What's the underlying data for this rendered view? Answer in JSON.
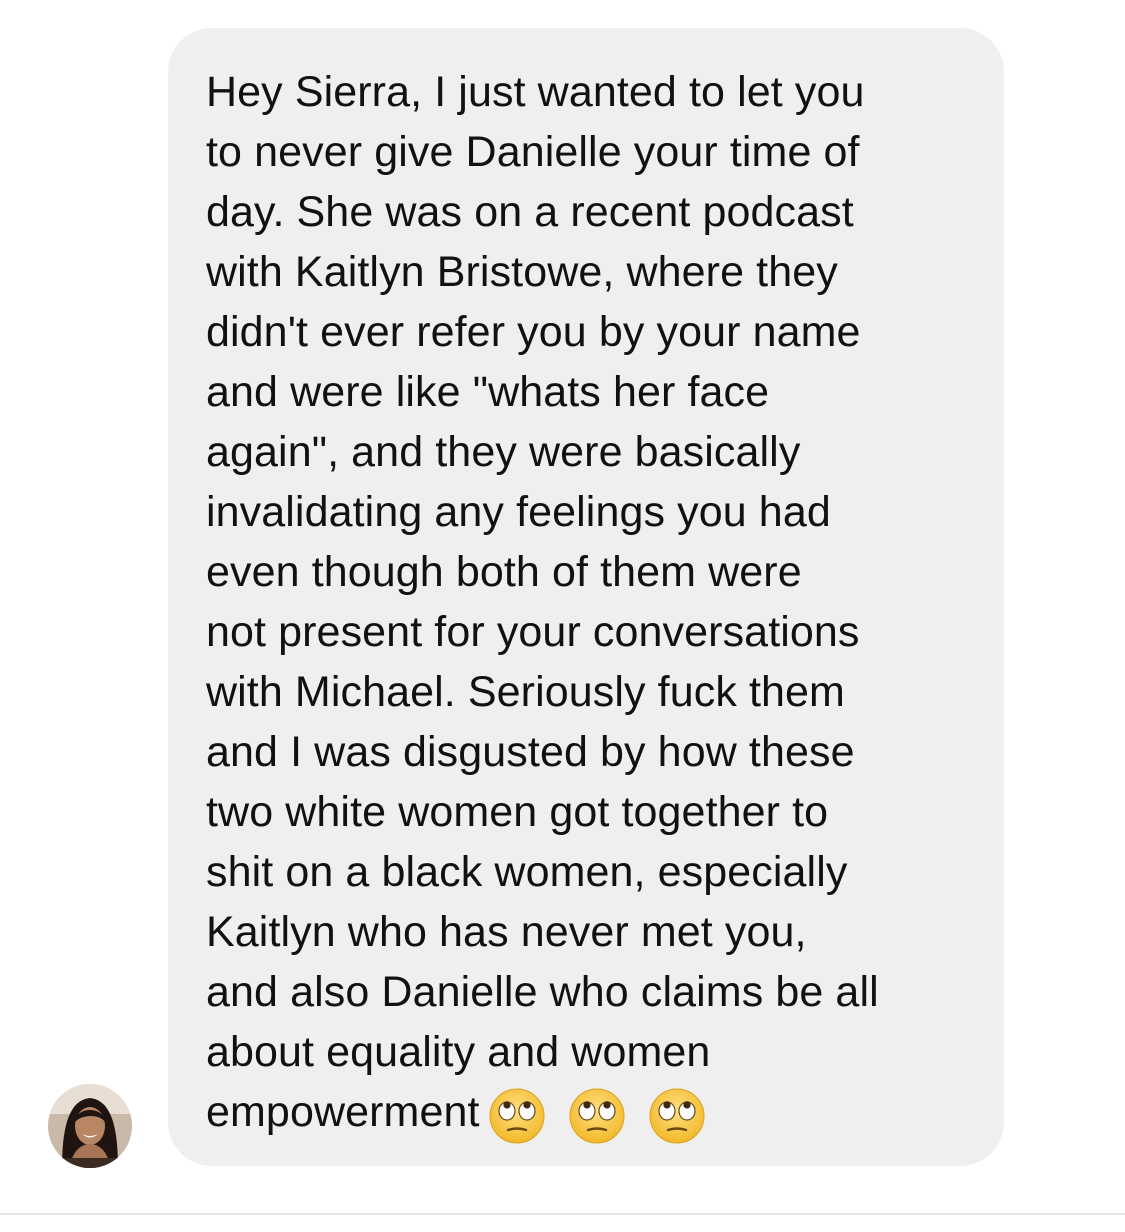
{
  "message": {
    "lines": [
      "Hey Sierra, I just wanted to let you",
      "to never give Danielle your time of",
      "day. She was on a recent podcast",
      "with Kaitlyn Bristowe, where they",
      "didn't ever refer you by your name",
      "and were like \"whats her face",
      "again\", and they were basically",
      "invalidating any feelings you had",
      "even though both of them were",
      "not present for your conversations",
      "with Michael. Seriously fuck them",
      "and I was disgusted by how these",
      "two white women got together to",
      "shit on a black women, especially",
      "Kaitlyn who has never met you,",
      "and also Danielle who claims be all",
      "about equality and women",
      "empowerment"
    ],
    "emojis": [
      "face-with-rolling-eyes-icon",
      "face-with-rolling-eyes-icon",
      "face-with-rolling-eyes-icon"
    ]
  },
  "sender": {
    "avatar_icon": "avatar-photo-icon"
  },
  "colors": {
    "bubble": "#efefef",
    "text": "#111111",
    "background": "#ffffff",
    "emoji_face": "#f7c534"
  }
}
